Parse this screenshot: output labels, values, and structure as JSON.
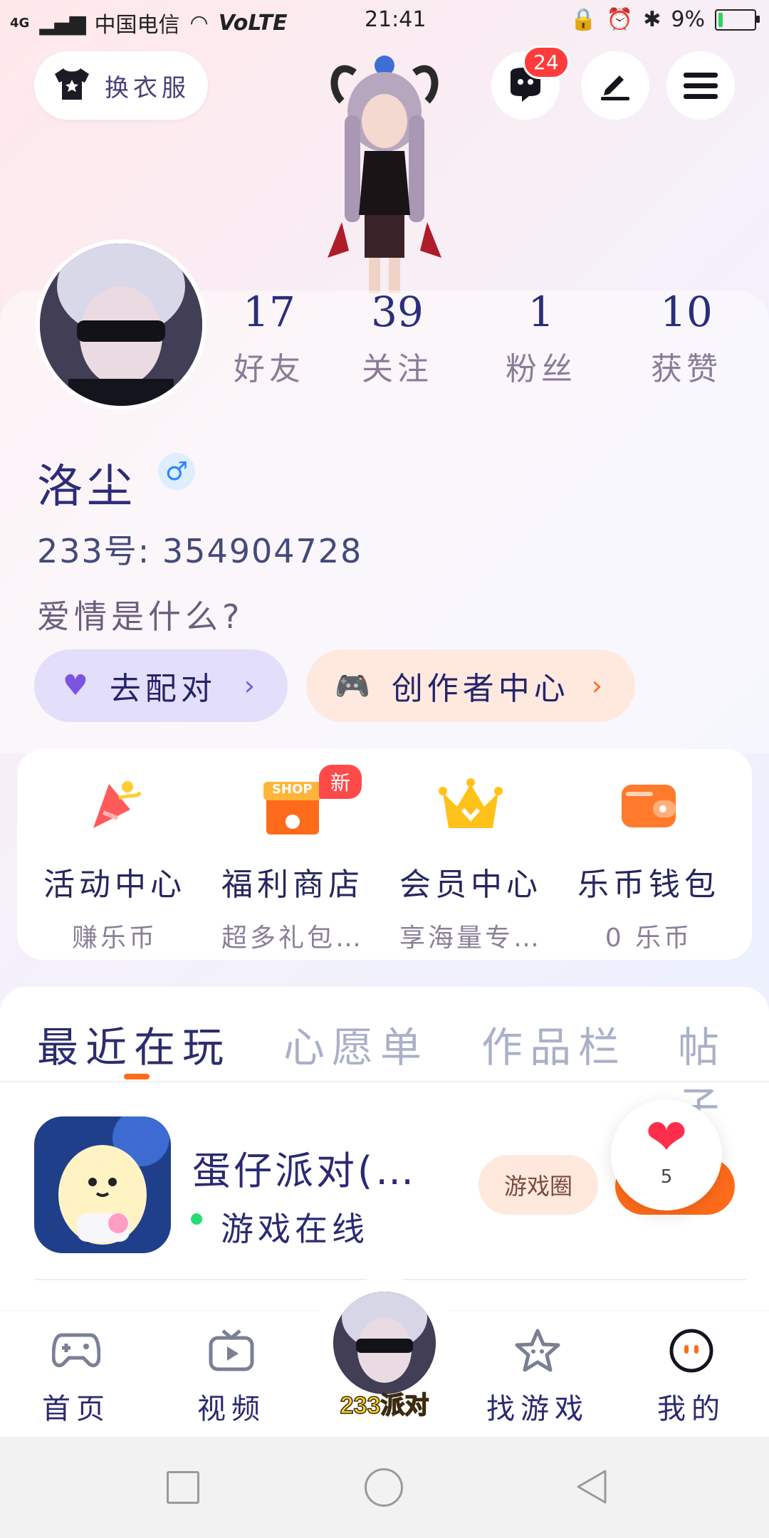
{
  "status_bar": {
    "network": "4G",
    "carrier": "中国电信",
    "volte": "VoLTE",
    "time": "21:41",
    "battery_percent": "9%",
    "battery_level": 0.09
  },
  "top": {
    "change_clothes_label": "换衣服",
    "message_badge": "24"
  },
  "profile": {
    "stats": [
      {
        "value": "17",
        "label": "好友"
      },
      {
        "value": "39",
        "label": "关注"
      },
      {
        "value": "1",
        "label": "粉丝"
      },
      {
        "value": "10",
        "label": "获赞"
      }
    ],
    "name": "洛尘",
    "gender_symbol": "♂",
    "id_line": "233号: 354904728",
    "bio": "爱情是什么?",
    "match_button": "去配对",
    "creator_button": "创作者中心"
  },
  "quick_actions": [
    {
      "title": "活动中心",
      "subtitle": "赚乐币"
    },
    {
      "title": "福利商店",
      "subtitle": "超多礼包…",
      "tag": "新",
      "shop_text": "SHOP"
    },
    {
      "title": "会员中心",
      "subtitle": "享海量专…"
    },
    {
      "title": "乐币钱包",
      "subtitle": "0 乐币"
    }
  ],
  "tabs": [
    "最近在玩",
    "心愿单",
    "作品栏",
    "帖子"
  ],
  "recent_game": {
    "title": "蛋仔派对(…",
    "status": "游戏在线",
    "circle_button": "游戏圈",
    "likes": "5"
  },
  "bottom_nav": [
    {
      "label": "首页"
    },
    {
      "label": "视频"
    },
    {
      "label": "233派对"
    },
    {
      "label": "找游戏"
    },
    {
      "label": "我的"
    }
  ],
  "colors": {
    "accent": "#ff6b1a",
    "badge": "#ff3b3b",
    "online": "#23dd74",
    "match_bg": "#e3defa",
    "creator_bg": "#ffe9df"
  }
}
